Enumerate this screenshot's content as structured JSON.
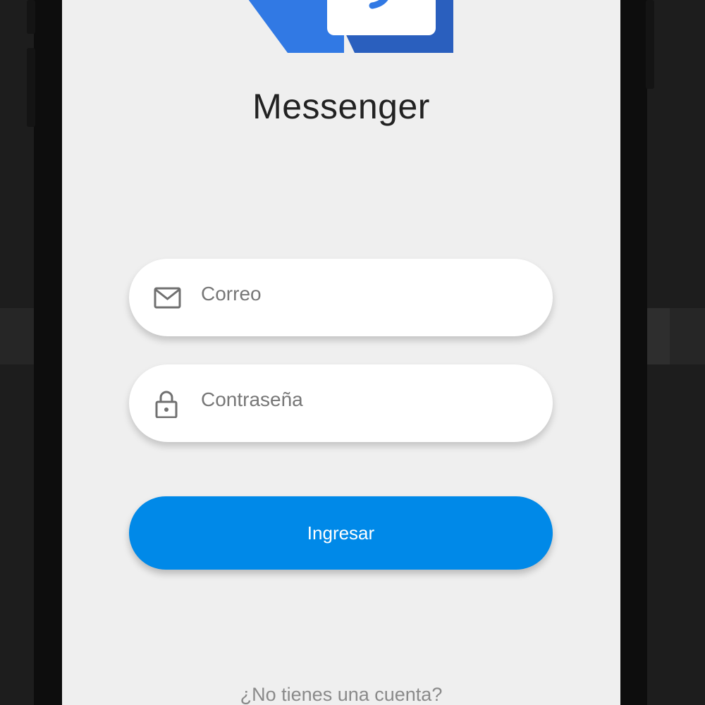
{
  "app": {
    "title": "Messenger"
  },
  "login_form": {
    "email": {
      "placeholder": "Correo",
      "value": "",
      "icon": "mail-icon"
    },
    "password": {
      "placeholder": "Contraseña",
      "value": "",
      "icon": "lock-icon"
    },
    "submit_label": "Ingresar",
    "signup_prompt": "¿No tienes una cuenta?"
  },
  "colors": {
    "screen_background": "#efefef",
    "primary_button": "#0089e8",
    "logo_blue": "#3179e4",
    "logo_dark_blue": "#2a5fbe",
    "device_frame": "#0d0d0d"
  }
}
